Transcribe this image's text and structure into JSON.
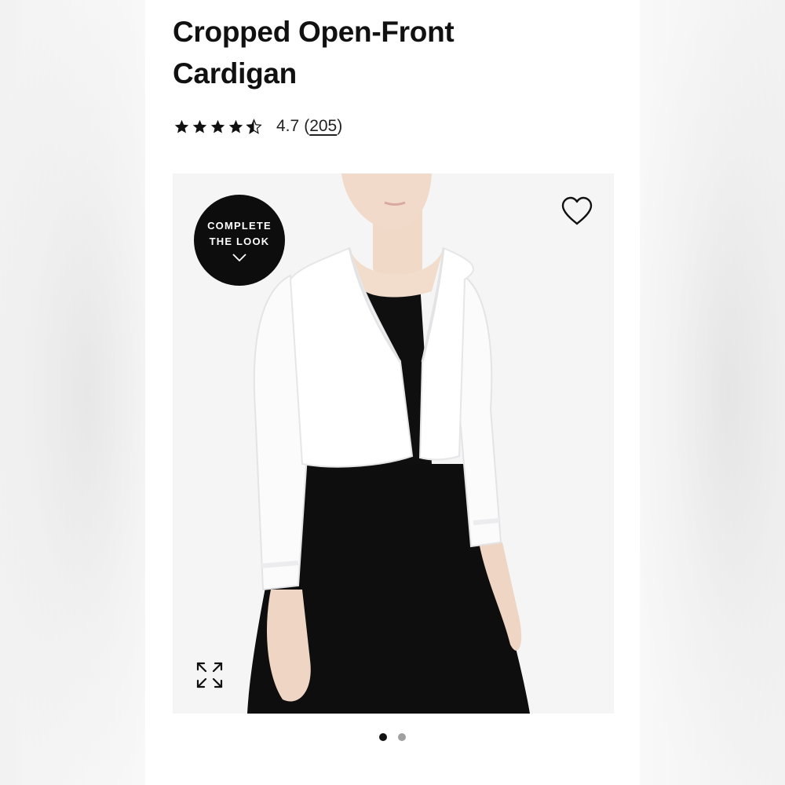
{
  "product": {
    "title_line1": "Cropped Open-Front",
    "title_line2": "Cardigan"
  },
  "rating": {
    "stars": 4.7,
    "value_text": "4.7",
    "count_open": "(",
    "count_text": "205",
    "count_close": ")"
  },
  "badge": {
    "line1": "COMPLETE",
    "line2": "THE LOOK",
    "icon": "chevron-down-icon"
  },
  "icons": {
    "favorite": "heart-icon",
    "expand": "expand-icon"
  },
  "carousel": {
    "total": 2,
    "active_index": 0,
    "active_color": "#111111",
    "inactive_color": "#a0a0a0"
  },
  "colors": {
    "image_background": "#f5f5f6",
    "badge_background": "#0d0d0d"
  }
}
